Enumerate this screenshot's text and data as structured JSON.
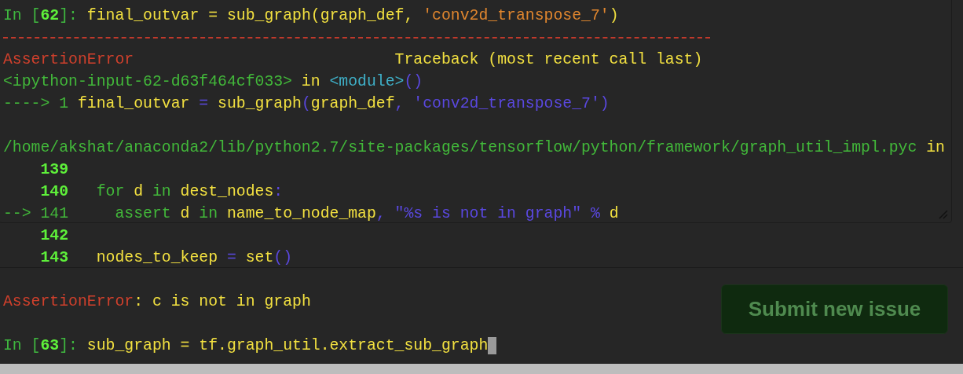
{
  "background_page": {
    "submit_button": {
      "label": "Submit new issue"
    }
  },
  "terminal": {
    "lines": [
      {
        "kind": "code",
        "segments": [
          {
            "text": "In [",
            "kind": "prompt"
          },
          {
            "text": "62",
            "kind": "prompt_num"
          },
          {
            "text": "]: ",
            "kind": "prompt"
          },
          {
            "text": "final_outvar = sub_graph(graph_def, ",
            "kind": "code"
          },
          {
            "text": "'conv2d_transpose_7'",
            "kind": "string"
          },
          {
            "text": ")",
            "kind": "code"
          }
        ]
      },
      {
        "kind": "rule"
      },
      {
        "kind": "header",
        "segments": [
          {
            "text": "AssertionError",
            "kind": "error"
          },
          {
            "text": "Traceback (most recent call last)",
            "kind": "code"
          }
        ]
      },
      {
        "kind": "code",
        "segments": [
          {
            "text": "<ipython-input-62-d63f464cf033>",
            "kind": "path"
          },
          {
            "text": " in ",
            "kind": "code"
          },
          {
            "text": "<module>",
            "kind": "module"
          },
          {
            "text": "()",
            "kind": "op"
          }
        ]
      },
      {
        "kind": "code",
        "segments": [
          {
            "text": "----> 1 ",
            "kind": "path"
          },
          {
            "text": "final_outvar ",
            "kind": "code"
          },
          {
            "text": "=",
            "kind": "op"
          },
          {
            "text": " sub_graph",
            "kind": "code"
          },
          {
            "text": "(",
            "kind": "op"
          },
          {
            "text": "graph_def",
            "kind": "code"
          },
          {
            "text": ", 'conv2d_transpose_7')",
            "kind": "op"
          }
        ]
      },
      {
        "kind": "blank"
      },
      {
        "kind": "code",
        "segments": [
          {
            "text": "/home/akshat/anaconda2/lib/python2.7/site-packages/tensorflow/python/framework/graph_util_impl.pyc",
            "kind": "path"
          },
          {
            "text": " in",
            "kind": "code"
          }
        ]
      },
      {
        "kind": "code",
        "segments": [
          {
            "text": "    139",
            "kind": "lineno"
          }
        ]
      },
      {
        "kind": "code",
        "segments": [
          {
            "text": "    140",
            "kind": "lineno"
          },
          {
            "text": "   for",
            "kind": "keyword"
          },
          {
            "text": " d ",
            "kind": "code"
          },
          {
            "text": "in",
            "kind": "keyword"
          },
          {
            "text": " dest_nodes",
            "kind": "code"
          },
          {
            "text": ":",
            "kind": "op"
          }
        ]
      },
      {
        "kind": "code",
        "segments": [
          {
            "text": "--> 141",
            "kind": "path"
          },
          {
            "text": "     assert",
            "kind": "keyword"
          },
          {
            "text": " d ",
            "kind": "code"
          },
          {
            "text": "in",
            "kind": "keyword"
          },
          {
            "text": " name_to_node_map",
            "kind": "code"
          },
          {
            "text": ", \"%s is not in graph\" % ",
            "kind": "op"
          },
          {
            "text": "d",
            "kind": "code"
          }
        ]
      },
      {
        "kind": "code",
        "segments": [
          {
            "text": "    142",
            "kind": "lineno"
          }
        ]
      },
      {
        "kind": "code",
        "segments": [
          {
            "text": "    143",
            "kind": "lineno"
          },
          {
            "text": "   nodes_to_keep ",
            "kind": "code"
          },
          {
            "text": "=",
            "kind": "op"
          },
          {
            "text": " set",
            "kind": "code"
          },
          {
            "text": "()",
            "kind": "op"
          }
        ]
      },
      {
        "kind": "blank"
      },
      {
        "kind": "code",
        "segments": [
          {
            "text": "AssertionError",
            "kind": "error"
          },
          {
            "text": ": c is not in graph",
            "kind": "code"
          }
        ]
      },
      {
        "kind": "blank"
      },
      {
        "kind": "code",
        "cursor": true,
        "segments": [
          {
            "text": "In [",
            "kind": "prompt"
          },
          {
            "text": "63",
            "kind": "prompt_num"
          },
          {
            "text": "]: ",
            "kind": "prompt"
          },
          {
            "text": "sub_graph = tf.graph_util.extract_sub_graph",
            "kind": "code"
          }
        ]
      }
    ]
  }
}
